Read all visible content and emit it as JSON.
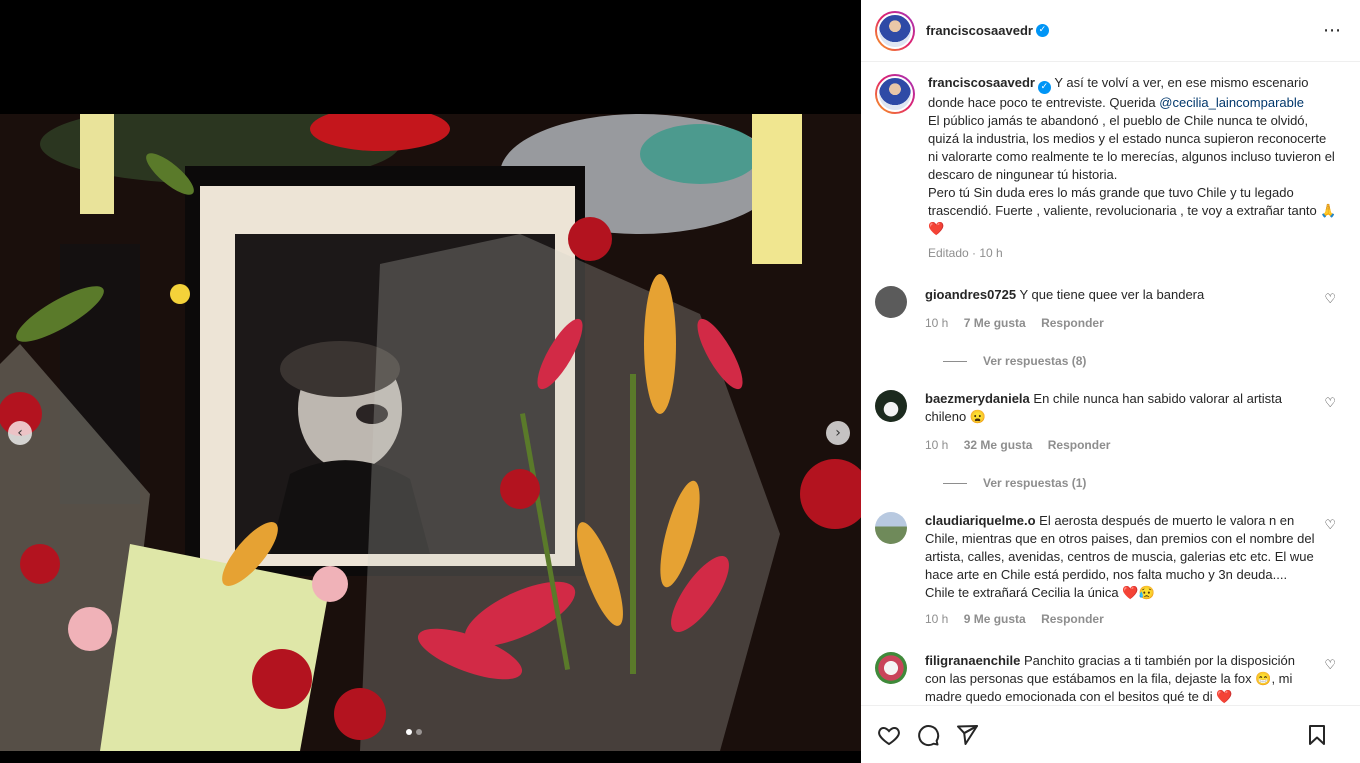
{
  "post": {
    "username": "franciscosaavedr",
    "verified_mark": "✓",
    "more_icon": "⋯",
    "caption": {
      "text_before": "Y así te volví a ver, en ese mismo escenario donde hace poco te entreviste. Querida ",
      "mention": "@cecilia_laincomparable",
      "text_after": "\nEl público jamás te abandonó , el pueblo de Chile nunca te olvidó, quizá la industria, los medios y el estado nunca supieron reconocerte ni valorarte como realmente te lo merecías, algunos incluso tuvieron el descaro de ningunear tú historia.\nPero tú Sin duda eres lo más grande que tuvo Chile y tu legado trascendió. Fuerte , valiente, revolucionaria , te voy a extrañar tanto 🙏❤️",
      "edited": "Editado · 10 h"
    },
    "carousel": {
      "prev_icon": "‹",
      "next_icon": "›",
      "slide_count": 2,
      "active_slide": 0
    }
  },
  "comments": [
    {
      "username": "gioandres0725",
      "text": "Y que tiene quee ver la bandera",
      "time": "10 h",
      "likes": "7 Me gusta",
      "reply": "Responder",
      "view_replies": "Ver respuestas (8)",
      "avatar_color": "#5b5b5b"
    },
    {
      "username": "baezmerydaniela",
      "text": "En chile nunca han sabido valorar al artista chileno 😦",
      "time": "10 h",
      "likes": "32 Me gusta",
      "reply": "Responder",
      "view_replies": "Ver respuestas (1)",
      "avatar_color": "#1c2a1e"
    },
    {
      "username": "claudiariquelme.o",
      "text": "El aerosta después de muerto le valora n en Chile, mientras que en otros paises, dan premios con el nombre del artista, calles, avenidas, centros de muscia, galerias etc etc. El wue hace arte en Chile está perdido, nos falta mucho y 3n deuda.... Chile te extrañará Cecilia la única ❤️😥",
      "time": "10 h",
      "likes": "9 Me gusta",
      "reply": "Responder",
      "avatar_color": "#6f8a5a"
    },
    {
      "username": "filigranaenchile",
      "text": "Panchito gracias a ti también por la disposición con las personas que estábamos en la fila, dejaste la fox 😁, mi madre quedo emocionada con el besitos qué te di ❤️",
      "avatar_color": "#c9445a"
    }
  ],
  "actions": {
    "like_icon": "heart-icon",
    "comment_icon": "comment-icon",
    "share_icon": "share-icon",
    "save_icon": "bookmark-icon"
  }
}
